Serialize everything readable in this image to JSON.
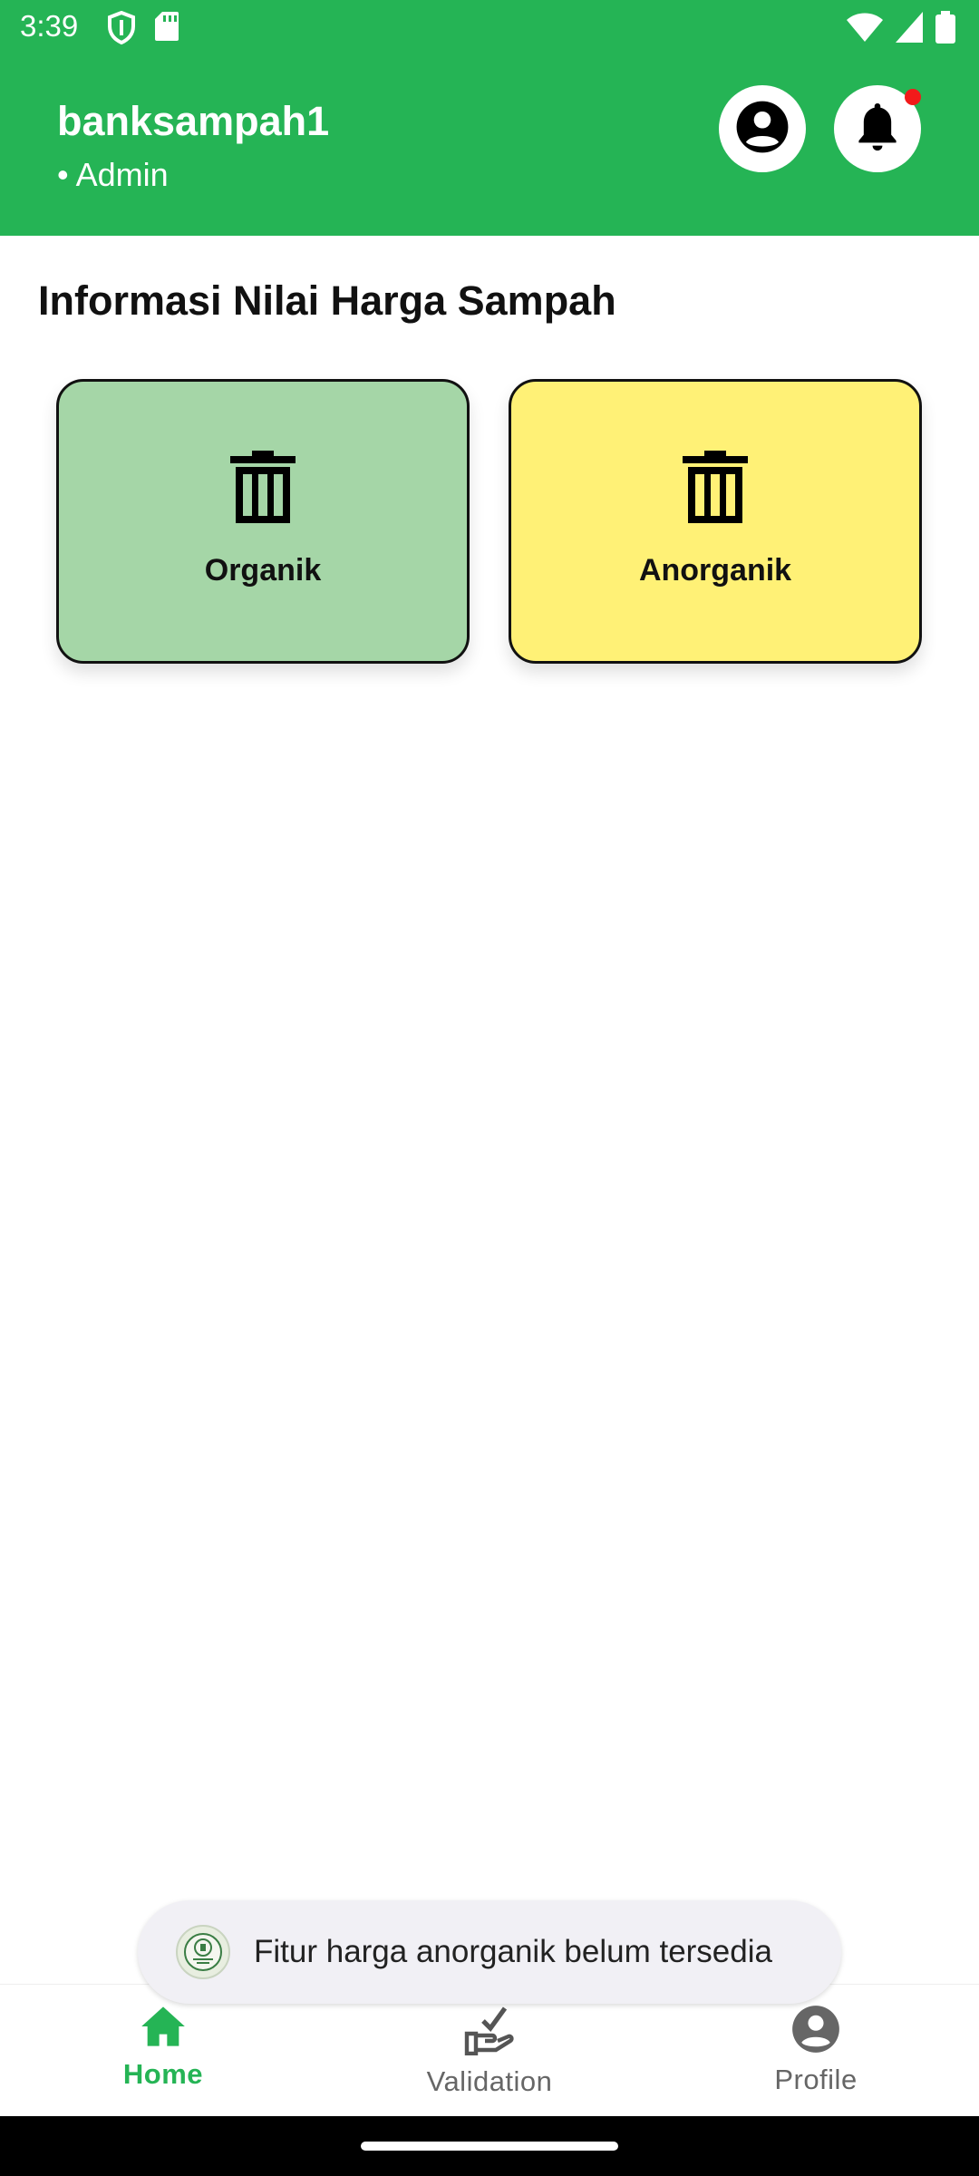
{
  "status_bar": {
    "time": "3:39",
    "left_icons": [
      "shield-icon",
      "sd-card-icon"
    ],
    "right_icons": [
      "wifi-icon",
      "signal-icon",
      "battery-icon"
    ]
  },
  "header": {
    "user_name": "banksampah1",
    "user_role": "• Admin",
    "background_color": "#25b455",
    "notification_dot_color": "#f21a1a"
  },
  "main": {
    "section_title": "Informasi Nilai Harga Sampah",
    "cards": [
      {
        "label": "Organik",
        "icon": "trash-icon",
        "color": "#a5d6a7"
      },
      {
        "label": "Anorganik",
        "icon": "trash-icon",
        "color": "#fff176"
      }
    ]
  },
  "toast": {
    "logo": "eco-trash-bank-logo",
    "message": "Fitur harga anorganik belum tersedia"
  },
  "bottom_nav": {
    "items": [
      {
        "label": "Home",
        "icon": "home-icon",
        "active": true
      },
      {
        "label": "Validation",
        "icon": "hand-check-icon",
        "active": false
      },
      {
        "label": "Profile",
        "icon": "account-circle-icon",
        "active": false
      }
    ],
    "active_color": "#25b455"
  }
}
